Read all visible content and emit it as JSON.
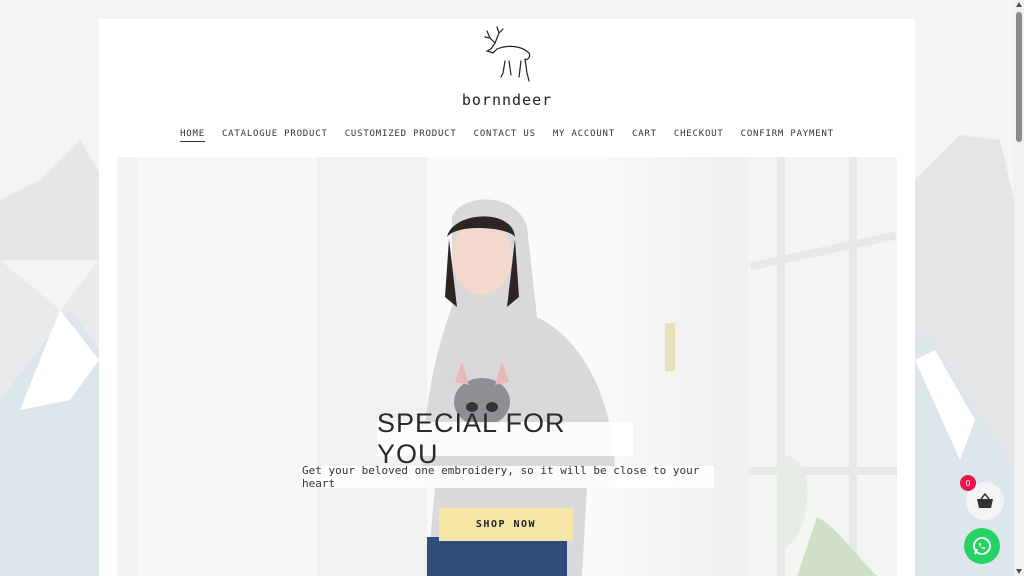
{
  "brand": {
    "name": "bornndeer",
    "logo_icon": "deer-logo-icon"
  },
  "nav": {
    "items": [
      {
        "label": "HOME",
        "active": true
      },
      {
        "label": "CATALOGUE PRODUCT"
      },
      {
        "label": "CUSTOMIZED PRODUCT"
      },
      {
        "label": "CONTACT US"
      },
      {
        "label": "MY ACCOUNT"
      },
      {
        "label": "CART"
      },
      {
        "label": "CHECKOUT"
      },
      {
        "label": "CONFIRM PAYMENT"
      }
    ]
  },
  "hero": {
    "title": "SPECIAL FOR YOU",
    "subtitle": "Get your beloved one embroidery, so it will be close to your heart",
    "button_label": "SHOP NOW",
    "button_color": "#f5e6a7"
  },
  "floating": {
    "cart_count": "0",
    "cart_icon": "basket-icon",
    "whatsapp_icon": "whatsapp-icon",
    "badge_color": "#e8174a",
    "whatsapp_color": "#25d366"
  }
}
